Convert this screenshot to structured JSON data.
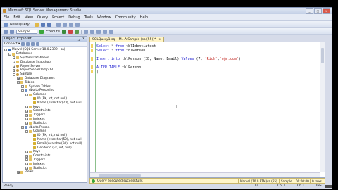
{
  "window": {
    "title": "Microsoft SQL Server Management Studio",
    "buttons": [
      "_",
      "□",
      "x"
    ]
  },
  "menu": [
    "File",
    "Edit",
    "View",
    "Query",
    "Project",
    "Debug",
    "Tools",
    "Window",
    "Community",
    "Help"
  ],
  "toolbar1": {
    "new_query": "New Query"
  },
  "toolbar2": {
    "database": "Sample",
    "execute": "Execute"
  },
  "object_explorer": {
    "title": "Object Explorer",
    "connect": "Connect ▾",
    "nodes": [
      {
        "level": 0,
        "exp": "-",
        "icon": "server",
        "label": "Marvel (SQL Server 10.0.2399 - sa)"
      },
      {
        "level": 1,
        "exp": "-",
        "icon": "folder",
        "label": "Databases"
      },
      {
        "level": 2,
        "exp": "+",
        "icon": "folder",
        "label": "System Databases"
      },
      {
        "level": 2,
        "exp": "+",
        "icon": "folder",
        "label": "Database Snapshots"
      },
      {
        "level": 2,
        "exp": "+",
        "icon": "db",
        "label": "ReportServer"
      },
      {
        "level": 2,
        "exp": "+",
        "icon": "db",
        "label": "ReportServerTempDB"
      },
      {
        "level": 2,
        "exp": "-",
        "icon": "db",
        "label": "Sample"
      },
      {
        "level": 3,
        "exp": "+",
        "icon": "folder",
        "label": "Database Diagrams"
      },
      {
        "level": 3,
        "exp": "-",
        "icon": "folder",
        "label": "Tables"
      },
      {
        "level": 4,
        "exp": "+",
        "icon": "folder",
        "label": "System Tables"
      },
      {
        "level": 4,
        "exp": "-",
        "icon": "table",
        "label": "dbo.tblPersonInc"
      },
      {
        "level": 5,
        "exp": "-",
        "icon": "folder",
        "label": "Columns"
      },
      {
        "level": 6,
        "exp": "",
        "icon": "key",
        "label": "ID (PK, int, not null)"
      },
      {
        "level": 6,
        "exp": "",
        "icon": "col",
        "label": "Name (nvarchar(20), not null)"
      },
      {
        "level": 5,
        "exp": "+",
        "icon": "folder",
        "label": "Keys"
      },
      {
        "level": 5,
        "exp": "+",
        "icon": "folder",
        "label": "Constraints"
      },
      {
        "level": 5,
        "exp": "+",
        "icon": "folder",
        "label": "Triggers"
      },
      {
        "level": 5,
        "exp": "+",
        "icon": "folder",
        "label": "Indexes"
      },
      {
        "level": 5,
        "exp": "+",
        "icon": "folder",
        "label": "Statistics"
      },
      {
        "level": 4,
        "exp": "-",
        "icon": "table",
        "label": "dbo.tblPerson"
      },
      {
        "level": 5,
        "exp": "-",
        "icon": "folder",
        "label": "Columns"
      },
      {
        "level": 6,
        "exp": "",
        "icon": "key",
        "label": "ID (PK, int, not null)"
      },
      {
        "level": 6,
        "exp": "",
        "icon": "col",
        "label": "Name (nvarchar(50), not null)"
      },
      {
        "level": 6,
        "exp": "",
        "icon": "col",
        "label": "Email (nvarchar(50), not null)"
      },
      {
        "level": 6,
        "exp": "",
        "icon": "col",
        "label": "GenderId (FK, int, null)"
      },
      {
        "level": 5,
        "exp": "+",
        "icon": "folder",
        "label": "Keys"
      },
      {
        "level": 5,
        "exp": "+",
        "icon": "folder",
        "label": "Constraints"
      },
      {
        "level": 5,
        "exp": "+",
        "icon": "folder",
        "label": "Triggers"
      },
      {
        "level": 5,
        "exp": "+",
        "icon": "folder",
        "label": "Indexes"
      },
      {
        "level": 5,
        "exp": "+",
        "icon": "folder",
        "label": "Statistics"
      },
      {
        "level": 3,
        "exp": "+",
        "icon": "folder",
        "label": "Views"
      }
    ]
  },
  "tab": {
    "label": "SQLQuery1.sql - M...A.Sample (sa (55))*",
    "close": "×"
  },
  "editor": {
    "lines": [
      [
        {
          "t": "Select",
          "c": "kw"
        },
        {
          "t": " * ",
          "c": "gr"
        },
        {
          "t": "from",
          "c": "kw"
        },
        {
          "t": " tblIdentiatest",
          "c": "id"
        }
      ],
      [
        {
          "t": "Select",
          "c": "kw"
        },
        {
          "t": " * ",
          "c": "gr"
        },
        {
          "t": "from",
          "c": "kw"
        },
        {
          "t": " tblPerson",
          "c": "id"
        }
      ],
      [],
      [
        {
          "t": "Insert into",
          "c": "kw"
        },
        {
          "t": " tblPerson (ID, Name, Email) ",
          "c": "id"
        },
        {
          "t": "Values",
          "c": "kw"
        },
        {
          "t": " (7, ",
          "c": "id"
        },
        {
          "t": "'Rich'",
          "c": "str"
        },
        {
          "t": ",",
          "c": "id"
        },
        {
          "t": "'r@r.com'",
          "c": "str"
        },
        {
          "t": ")",
          "c": "id"
        }
      ],
      [],
      [
        {
          "t": "ALTER TABLE",
          "c": "kw"
        },
        {
          "t": " tblPerson",
          "c": "id"
        }
      ],
      [
        {
          "t": "|",
          "c": "id"
        }
      ]
    ]
  },
  "query_status": {
    "message": "Query executed successfully.",
    "server": "Marvel (10.0 RTM)",
    "user": "sa (55)",
    "database": "Sample",
    "time": "00:00:00",
    "rows": "0 rows"
  },
  "status_bar": {
    "ready": "Ready",
    "ln": "Ln 7",
    "col": "Col 1",
    "ch": "Ch 1",
    "ins": "INS"
  },
  "colors": {
    "accent": "#3b6fb6",
    "status_ok": "#3aa63a",
    "keyword": "#2020d0",
    "string": "#c0201a"
  }
}
